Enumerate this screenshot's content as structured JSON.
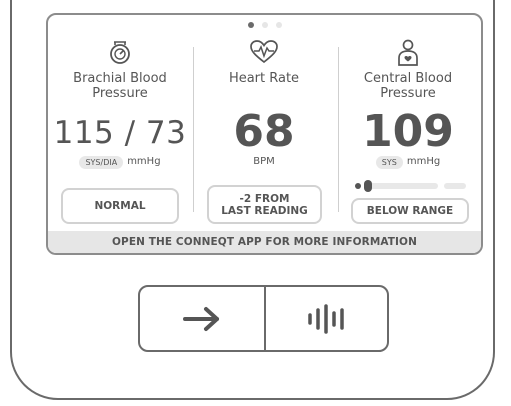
{
  "pager": {
    "page_count": 3,
    "active_page": 1
  },
  "brachial": {
    "title": "Brachial Blood\nPressure",
    "value": "115 / 73",
    "unit_badge": "SYS/DIA",
    "unit": "mmHg",
    "status": "NORMAL",
    "icon": "gauge-icon"
  },
  "heart_rate": {
    "title": "Heart Rate",
    "value": "68",
    "unit": "BPM",
    "status": "-2 FROM\nLAST READING",
    "icon": "heart-pulse-icon"
  },
  "central": {
    "title": "Central Blood\nPressure",
    "value": "109",
    "unit_badge": "SYS",
    "unit": "mmHg",
    "status": "BELOW RANGE",
    "icon": "person-heart-icon",
    "range_level": 0.08
  },
  "footer": {
    "text": "OPEN THE CONNEQT APP FOR MORE INFORMATION"
  },
  "buttons": {
    "next_icon": "arrow-right-icon",
    "audio_icon": "waveform-icon"
  }
}
